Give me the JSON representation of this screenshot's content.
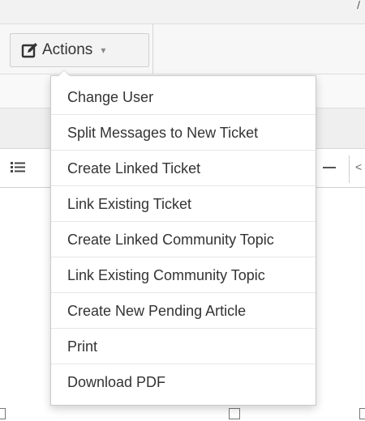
{
  "top_strip": {
    "fragment": "/"
  },
  "toolbar": {
    "actions_label": "Actions",
    "actions_icon": "edit-icon",
    "caret_glyph": "▾"
  },
  "editor": {
    "left_arrow_glyph": "<"
  },
  "menu": {
    "items": [
      {
        "label": "Change User"
      },
      {
        "label": "Split Messages to New Ticket"
      },
      {
        "label": "Create Linked Ticket"
      },
      {
        "label": "Link Existing Ticket"
      },
      {
        "label": "Create Linked Community Topic"
      },
      {
        "label": "Link Existing Community Topic"
      },
      {
        "label": "Create New Pending Article"
      },
      {
        "label": "Print"
      },
      {
        "label": "Download PDF"
      }
    ]
  },
  "colors": {
    "toolbar_bg": "#f7f7f7",
    "menu_border": "#c9c9c9",
    "text": "#333333"
  }
}
